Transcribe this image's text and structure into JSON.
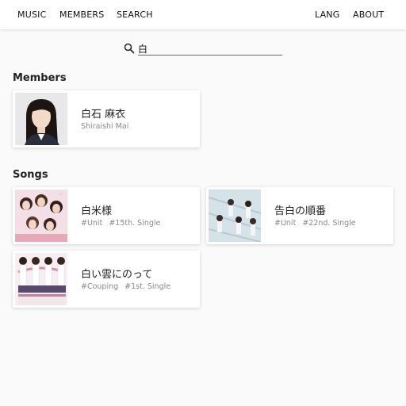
{
  "nav": {
    "music": "MUSIC",
    "members": "MEMBERS",
    "search": "SEARCH",
    "lang": "LANG",
    "about": "ABOUT"
  },
  "search": {
    "value": "白",
    "icon": "search-icon"
  },
  "members_section": {
    "title": "Members",
    "items": [
      {
        "name": "白石 麻衣",
        "romaji": "Shiraishi Mai"
      }
    ]
  },
  "songs_section": {
    "title": "Songs",
    "items": [
      {
        "title": "白米様",
        "tags": [
          "#Unit",
          "#15th. Single"
        ]
      },
      {
        "title": "告白の順番",
        "tags": [
          "#Unit",
          "#22nd. Single"
        ]
      },
      {
        "title": "白い雲にのって",
        "tags": [
          "#Couping",
          "#1st. Single"
        ]
      }
    ]
  },
  "colors": {
    "background": "#fafafa",
    "card": "#ffffff",
    "subtext": "#888888"
  }
}
